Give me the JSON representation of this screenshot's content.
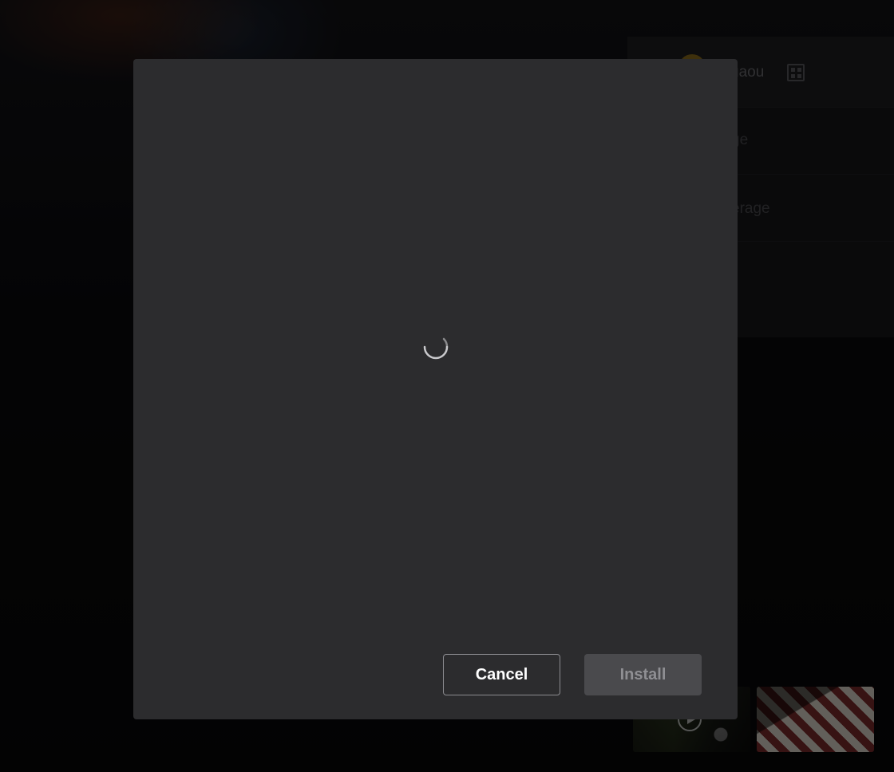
{
  "background": {
    "username": "uaou",
    "rows": [
      {
        "label": "ge"
      },
      {
        "label": "erage"
      }
    ],
    "thumbnails": [
      {
        "icon": "play-icon"
      },
      {
        "icon": ""
      }
    ]
  },
  "dialog": {
    "loading": true,
    "cancel_label": "Cancel",
    "install_label": "Install",
    "install_enabled": false
  },
  "colors": {
    "modal_bg": "#2c2c2e",
    "cancel_border": "#8b8b8f",
    "install_bg_disabled": "#4a4a4d",
    "install_text_disabled": "#8f8f93"
  }
}
